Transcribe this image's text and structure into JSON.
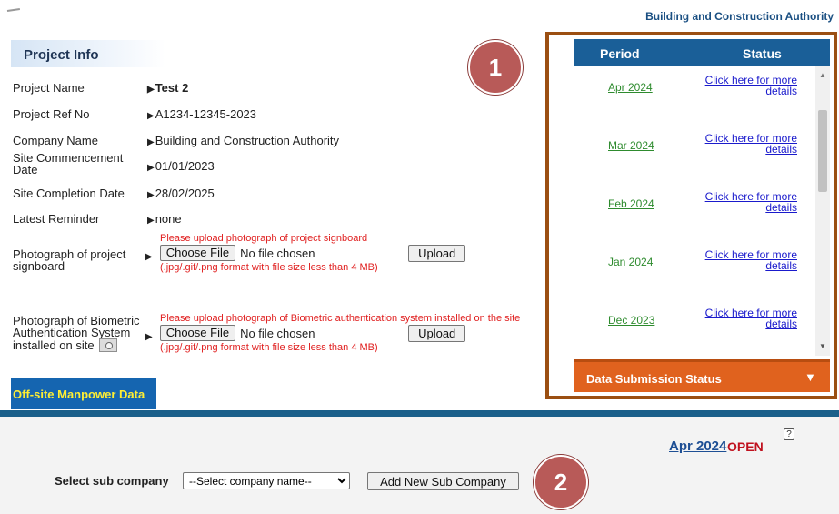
{
  "header": {
    "org_name": "Building and Construction Authority"
  },
  "project_info": {
    "title": "Project Info",
    "fields": [
      {
        "label": "Project Name",
        "value": "Test 2"
      },
      {
        "label": "Project Ref No",
        "value": "A1234-12345-2023"
      },
      {
        "label": "Company Name",
        "value": "Building and Construction Authority"
      },
      {
        "label": "Site Commencement Date",
        "value": "01/01/2023"
      },
      {
        "label": "Site Completion Date",
        "value": "28/02/2025"
      },
      {
        "label": "Latest Reminder",
        "value": "none"
      }
    ],
    "uploads": [
      {
        "label": "Photograph of project signboard",
        "hint": "Please upload photograph of project signboard",
        "choose_label": "Choose File",
        "file_status": "No file chosen",
        "upload_label": "Upload",
        "format_note": "(.jpg/.gif/.png format with file size less than 4 MB)"
      },
      {
        "label": "Photograph of Biometric Authentication System installed on site",
        "hint": "Please upload photograph of Biometric authentication system installed on the site",
        "choose_label": "Choose File",
        "file_status": "No file chosen",
        "upload_label": "Upload",
        "format_note": "(.jpg/.gif/.png format with file size less than 4 MB)"
      }
    ]
  },
  "offsite_tab": {
    "label": "Off-site Manpower Data"
  },
  "status_panel": {
    "headers": {
      "period": "Period",
      "status": "Status"
    },
    "rows": [
      {
        "period": "Apr 2024",
        "status": "Click here for more details"
      },
      {
        "period": "Mar 2024",
        "status": "Click here for more details"
      },
      {
        "period": "Feb 2024",
        "status": "Click here for more details"
      },
      {
        "period": "Jan 2024",
        "status": "Click here for more details"
      },
      {
        "period": "Dec 2023",
        "status": "Click here for more details"
      }
    ],
    "footer": {
      "label": "Data Submission Status",
      "caret": "▼"
    }
  },
  "current_period": {
    "label": "Apr 2024",
    "status": "OPEN",
    "help_icon": "?"
  },
  "sub_company": {
    "label": "Select sub company",
    "selected": "--Select company name--",
    "add_button": "Add New Sub Company"
  },
  "badges": [
    "1",
    "2"
  ],
  "colors": {
    "header_blue": "#1a5f98",
    "accent_orange": "#e0621e",
    "frame_brown": "#9b4f12",
    "badge": "#b85a58",
    "error_red": "#e02020",
    "link_green": "#2e8b2e",
    "tab_yellow": "#ffee33"
  }
}
